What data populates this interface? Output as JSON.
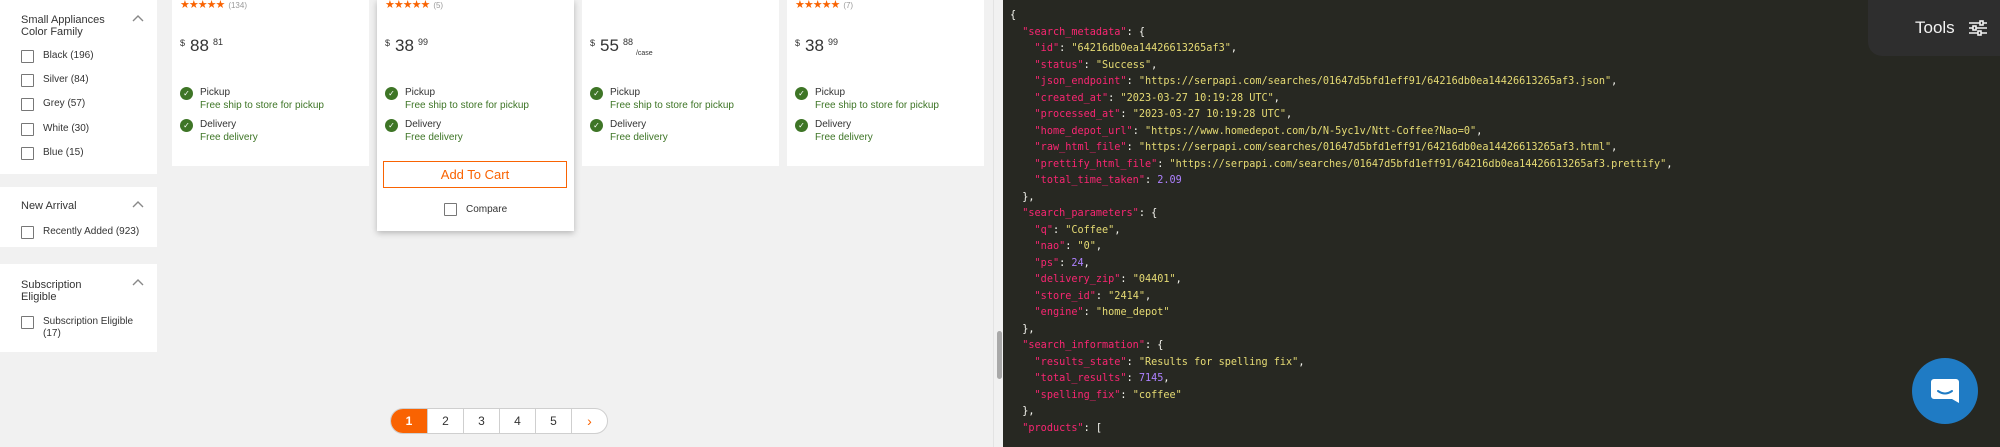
{
  "filters": {
    "color_family": {
      "title_line1": "Small Appliances",
      "title_line2": "Color Family",
      "options": [
        {
          "label": "Black (196)"
        },
        {
          "label": "Silver (84)"
        },
        {
          "label": "Grey (57)"
        },
        {
          "label": "White (30)"
        },
        {
          "label": "Blue (15)"
        }
      ]
    },
    "new_arrival": {
      "title": "New Arrival",
      "options": [
        {
          "label": "Recently Added (923)"
        }
      ]
    },
    "subscription": {
      "title_line1": "Subscription",
      "title_line2": "Eligible",
      "options": [
        {
          "label_line1": "Subscription Eligible",
          "label_line2": "(17)"
        }
      ]
    }
  },
  "products": [
    {
      "stars": "★★★★★",
      "review_count": "(134)",
      "currency": "$",
      "dollars": "88",
      "cents": "81",
      "unit": "",
      "pickup_label": "Pickup",
      "pickup_detail": "Free ship to store for pickup",
      "delivery_label": "Delivery",
      "delivery_detail": "Free delivery"
    },
    {
      "stars": "★★★★★",
      "review_count": "(5)",
      "currency": "$",
      "dollars": "38",
      "cents": "99",
      "unit": "",
      "pickup_label": "Pickup",
      "pickup_detail": "Free ship to store for pickup",
      "delivery_label": "Delivery",
      "delivery_detail": "Free delivery",
      "add_to_cart": "Add To Cart",
      "compare": "Compare"
    },
    {
      "stars": "",
      "review_count": "",
      "currency": "$",
      "dollars": "55",
      "cents": "88",
      "unit": "/case",
      "pickup_label": "Pickup",
      "pickup_detail": "Free ship to store for pickup",
      "delivery_label": "Delivery",
      "delivery_detail": "Free delivery"
    },
    {
      "stars": "★★★★★",
      "review_count": "(7)",
      "currency": "$",
      "dollars": "38",
      "cents": "99",
      "unit": "",
      "pickup_label": "Pickup",
      "pickup_detail": "Free ship to store for pickup",
      "delivery_label": "Delivery",
      "delivery_detail": "Free delivery"
    }
  ],
  "pagination": {
    "pages": [
      "1",
      "2",
      "3",
      "4",
      "5"
    ],
    "current": "1",
    "next": "›"
  },
  "tools": {
    "label": "Tools"
  },
  "json_view": {
    "lines": [
      [
        {
          "t": "{",
          "c": "p"
        }
      ],
      [
        {
          "t": "  ",
          "c": "p"
        },
        {
          "t": "\"search_metadata\"",
          "c": "k"
        },
        {
          "t": ": {",
          "c": "p"
        }
      ],
      [
        {
          "t": "    ",
          "c": "p"
        },
        {
          "t": "\"id\"",
          "c": "k"
        },
        {
          "t": ": ",
          "c": "p"
        },
        {
          "t": "\"64216db0ea14426613265af3\"",
          "c": "s"
        },
        {
          "t": ",",
          "c": "p"
        }
      ],
      [
        {
          "t": "    ",
          "c": "p"
        },
        {
          "t": "\"status\"",
          "c": "k"
        },
        {
          "t": ": ",
          "c": "p"
        },
        {
          "t": "\"Success\"",
          "c": "s"
        },
        {
          "t": ",",
          "c": "p"
        }
      ],
      [
        {
          "t": "    ",
          "c": "p"
        },
        {
          "t": "\"json_endpoint\"",
          "c": "k"
        },
        {
          "t": ": ",
          "c": "p"
        },
        {
          "t": "\"https://serpapi.com/searches/01647d5bfd1eff91/64216db0ea14426613265af3.json\"",
          "c": "s"
        },
        {
          "t": ",",
          "c": "p"
        }
      ],
      [
        {
          "t": "    ",
          "c": "p"
        },
        {
          "t": "\"created_at\"",
          "c": "k"
        },
        {
          "t": ": ",
          "c": "p"
        },
        {
          "t": "\"2023-03-27 10:19:28 UTC\"",
          "c": "s"
        },
        {
          "t": ",",
          "c": "p"
        }
      ],
      [
        {
          "t": "    ",
          "c": "p"
        },
        {
          "t": "\"processed_at\"",
          "c": "k"
        },
        {
          "t": ": ",
          "c": "p"
        },
        {
          "t": "\"2023-03-27 10:19:28 UTC\"",
          "c": "s"
        },
        {
          "t": ",",
          "c": "p"
        }
      ],
      [
        {
          "t": "    ",
          "c": "p"
        },
        {
          "t": "\"home_depot_url\"",
          "c": "k"
        },
        {
          "t": ": ",
          "c": "p"
        },
        {
          "t": "\"https://www.homedepot.com/b/N-5yc1v/Ntt-Coffee?Nao=0\"",
          "c": "s"
        },
        {
          "t": ",",
          "c": "p"
        }
      ],
      [
        {
          "t": "    ",
          "c": "p"
        },
        {
          "t": "\"raw_html_file\"",
          "c": "k"
        },
        {
          "t": ": ",
          "c": "p"
        },
        {
          "t": "\"https://serpapi.com/searches/01647d5bfd1eff91/64216db0ea14426613265af3.html\"",
          "c": "s"
        },
        {
          "t": ",",
          "c": "p"
        }
      ],
      [
        {
          "t": "    ",
          "c": "p"
        },
        {
          "t": "\"prettify_html_file\"",
          "c": "k"
        },
        {
          "t": ": ",
          "c": "p"
        },
        {
          "t": "\"https://serpapi.com/searches/01647d5bfd1eff91/64216db0ea14426613265af3.prettify\"",
          "c": "s"
        },
        {
          "t": ",",
          "c": "p"
        }
      ],
      [
        {
          "t": "    ",
          "c": "p"
        },
        {
          "t": "\"total_time_taken\"",
          "c": "k"
        },
        {
          "t": ": ",
          "c": "p"
        },
        {
          "t": "2.09",
          "c": "n"
        }
      ],
      [
        {
          "t": "  },",
          "c": "p"
        }
      ],
      [
        {
          "t": "  ",
          "c": "p"
        },
        {
          "t": "\"search_parameters\"",
          "c": "k"
        },
        {
          "t": ": {",
          "c": "p"
        }
      ],
      [
        {
          "t": "    ",
          "c": "p"
        },
        {
          "t": "\"q\"",
          "c": "k"
        },
        {
          "t": ": ",
          "c": "p"
        },
        {
          "t": "\"Coffee\"",
          "c": "s"
        },
        {
          "t": ",",
          "c": "p"
        }
      ],
      [
        {
          "t": "    ",
          "c": "p"
        },
        {
          "t": "\"nao\"",
          "c": "k"
        },
        {
          "t": ": ",
          "c": "p"
        },
        {
          "t": "\"0\"",
          "c": "s"
        },
        {
          "t": ",",
          "c": "p"
        }
      ],
      [
        {
          "t": "    ",
          "c": "p"
        },
        {
          "t": "\"ps\"",
          "c": "k"
        },
        {
          "t": ": ",
          "c": "p"
        },
        {
          "t": "24",
          "c": "n"
        },
        {
          "t": ",",
          "c": "p"
        }
      ],
      [
        {
          "t": "    ",
          "c": "p"
        },
        {
          "t": "\"delivery_zip\"",
          "c": "k"
        },
        {
          "t": ": ",
          "c": "p"
        },
        {
          "t": "\"04401\"",
          "c": "s"
        },
        {
          "t": ",",
          "c": "p"
        }
      ],
      [
        {
          "t": "    ",
          "c": "p"
        },
        {
          "t": "\"store_id\"",
          "c": "k"
        },
        {
          "t": ": ",
          "c": "p"
        },
        {
          "t": "\"2414\"",
          "c": "s"
        },
        {
          "t": ",",
          "c": "p"
        }
      ],
      [
        {
          "t": "    ",
          "c": "p"
        },
        {
          "t": "\"engine\"",
          "c": "k"
        },
        {
          "t": ": ",
          "c": "p"
        },
        {
          "t": "\"home_depot\"",
          "c": "s"
        }
      ],
      [
        {
          "t": "  },",
          "c": "p"
        }
      ],
      [
        {
          "t": "  ",
          "c": "p"
        },
        {
          "t": "\"search_information\"",
          "c": "k"
        },
        {
          "t": ": {",
          "c": "p"
        }
      ],
      [
        {
          "t": "    ",
          "c": "p"
        },
        {
          "t": "\"results_state\"",
          "c": "k"
        },
        {
          "t": ": ",
          "c": "p"
        },
        {
          "t": "\"Results for spelling fix\"",
          "c": "s"
        },
        {
          "t": ",",
          "c": "p"
        }
      ],
      [
        {
          "t": "    ",
          "c": "p"
        },
        {
          "t": "\"total_results\"",
          "c": "k"
        },
        {
          "t": ": ",
          "c": "p"
        },
        {
          "t": "7145",
          "c": "n"
        },
        {
          "t": ",",
          "c": "p"
        }
      ],
      [
        {
          "t": "    ",
          "c": "p"
        },
        {
          "t": "\"spelling_fix\"",
          "c": "k"
        },
        {
          "t": ": ",
          "c": "p"
        },
        {
          "t": "\"coffee\"",
          "c": "s"
        }
      ],
      [
        {
          "t": "  },",
          "c": "p"
        }
      ],
      [
        {
          "t": "  ",
          "c": "p"
        },
        {
          "t": "\"products\"",
          "c": "k"
        },
        {
          "t": ": [",
          "c": "p"
        }
      ]
    ]
  },
  "colors": {
    "brand_orange": "#f96302",
    "fulfillment_green": "#3e7526",
    "code_background": "#272822",
    "json_key": "#f92672",
    "json_string": "#e6db74",
    "json_number": "#ae81ff",
    "chat_button": "#1f7bc4"
  }
}
